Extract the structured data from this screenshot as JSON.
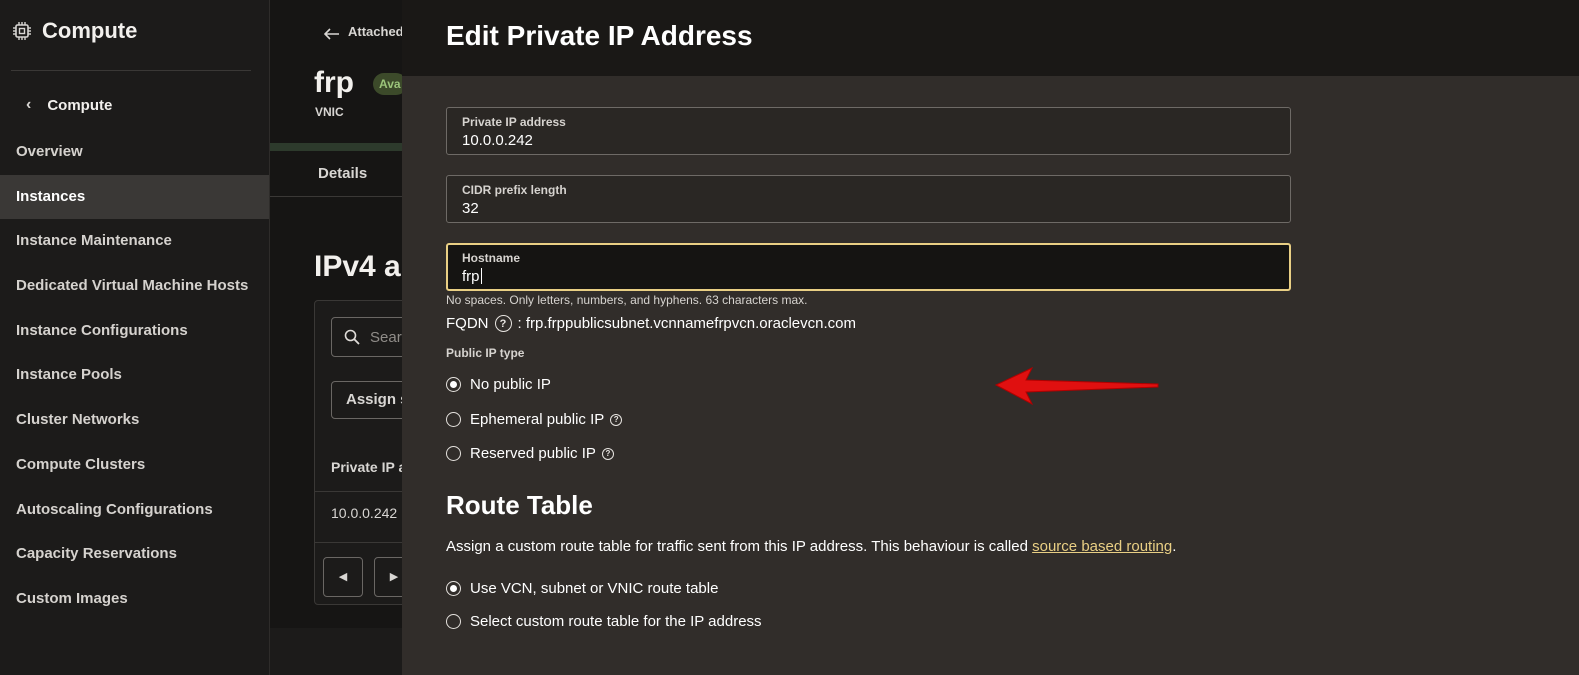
{
  "sidebar": {
    "title": "Compute",
    "back_label": "Compute",
    "items": [
      {
        "label": "Overview",
        "active": false
      },
      {
        "label": "Instances",
        "active": true
      },
      {
        "label": "Instance Maintenance",
        "active": false
      },
      {
        "label": "Dedicated Virtual Machine Hosts",
        "active": false
      },
      {
        "label": "Instance Configurations",
        "active": false
      },
      {
        "label": "Instance Pools",
        "active": false
      },
      {
        "label": "Cluster Networks",
        "active": false
      },
      {
        "label": "Compute Clusters",
        "active": false
      },
      {
        "label": "Autoscaling Configurations",
        "active": false
      },
      {
        "label": "Capacity Reservations",
        "active": false
      },
      {
        "label": "Custom Images",
        "active": false
      }
    ]
  },
  "background": {
    "back_label": "Attached",
    "title": "frp",
    "badge": "Ava",
    "subtitle": "VNIC",
    "tab": "Details",
    "section_title": "IPv4 a",
    "search_placeholder": "Sear",
    "assign_label": "Assign s",
    "column_header": "Private IP a",
    "cell_value": "10.0.0.242"
  },
  "panel": {
    "title": "Edit Private IP Address",
    "private_ip": {
      "label": "Private IP address",
      "value": "10.0.0.242"
    },
    "cidr": {
      "label": "CIDR prefix length",
      "value": "32"
    },
    "hostname": {
      "label": "Hostname",
      "value": "frp",
      "help": "No spaces. Only letters, numbers, and hyphens. 63 characters max."
    },
    "fqdn": {
      "label": "FQDN",
      "value": ": frp.frppublicsubnet.vcnnamefrpvcn.oraclevcn.com"
    },
    "public_ip_type": {
      "label": "Public IP type",
      "options": [
        {
          "label": "No public IP",
          "checked": true
        },
        {
          "label": "Ephemeral public IP",
          "checked": false
        },
        {
          "label": "Reserved public IP",
          "checked": false
        }
      ]
    },
    "route_table": {
      "title": "Route Table",
      "description": "Assign a custom route table for traffic sent from this IP address. This behaviour is called ",
      "link": "source based routing",
      "suffix": ".",
      "options": [
        {
          "label": "Use VCN, subnet or VNIC route table",
          "checked": true
        },
        {
          "label": "Select custom route table for the IP address",
          "checked": false
        }
      ]
    }
  },
  "colors": {
    "accent": "#e9cf84",
    "annotation_arrow": "#e01010",
    "panel_bg": "#312d2a"
  },
  "icons": [
    "chip-icon",
    "chevron-left-icon",
    "arrow-left-icon",
    "search-icon",
    "help-icon",
    "annotation-arrow-icon"
  ]
}
